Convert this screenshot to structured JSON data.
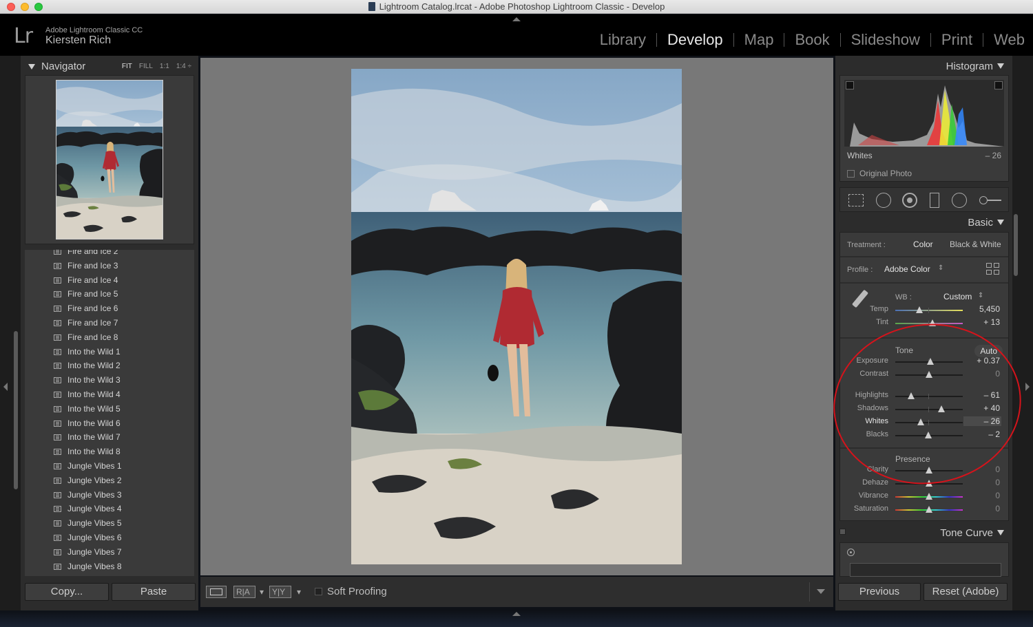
{
  "window": {
    "title": "Lightroom Catalog.lrcat - Adobe Photoshop Lightroom Classic - Develop"
  },
  "identity": {
    "logo": "Lr",
    "product": "Adobe Lightroom Classic CC",
    "user": "Kiersten Rich"
  },
  "modules": [
    "Library",
    "Develop",
    "Map",
    "Book",
    "Slideshow",
    "Print",
    "Web"
  ],
  "active_module": "Develop",
  "navigator": {
    "title": "Navigator",
    "zoom": [
      "FIT",
      "FILL",
      "1:1",
      "1:4 ÷"
    ]
  },
  "presets": [
    "Fire and Ice 2",
    "Fire and Ice 3",
    "Fire and Ice 4",
    "Fire and Ice 5",
    "Fire and Ice 6",
    "Fire and Ice 7",
    "Fire and Ice 8",
    "Into the Wild 1",
    "Into the Wild 2",
    "Into the Wild 3",
    "Into the Wild 4",
    "Into the Wild 5",
    "Into the Wild 6",
    "Into the Wild 7",
    "Into the Wild 8",
    "Jungle Vibes 1",
    "Jungle Vibes 2",
    "Jungle Vibes 3",
    "Jungle Vibes 4",
    "Jungle Vibes 5",
    "Jungle Vibes 6",
    "Jungle Vibes 7",
    "Jungle Vibes 8"
  ],
  "left_buttons": {
    "copy": "Copy...",
    "paste": "Paste"
  },
  "toolbar": {
    "soft_proofing": "Soft Proofing",
    "before_after_1": "R|A",
    "before_after_2": "Y|Y"
  },
  "histogram": {
    "title": "Histogram",
    "label": "Whites",
    "value": "– 26",
    "original_photo": "Original Photo"
  },
  "basic": {
    "title": "Basic",
    "treatment_label": "Treatment :",
    "treatment_color": "Color",
    "treatment_bw": "Black & White",
    "profile_label": "Profile :",
    "profile_value": "Adobe Color",
    "wb_label": "WB :",
    "wb_value": "Custom",
    "tone_title": "Tone",
    "auto": "Auto",
    "presence_title": "Presence",
    "sliders": [
      {
        "label": "Temp",
        "value": "5,450",
        "pos": 0.36,
        "group": "wb"
      },
      {
        "label": "Tint",
        "value": "+ 13",
        "pos": 0.55,
        "group": "wb"
      },
      {
        "label": "Exposure",
        "value": "+ 0.37",
        "pos": 0.52,
        "group": "tone"
      },
      {
        "label": "Contrast",
        "value": "0",
        "pos": 0.5,
        "group": "tone"
      },
      {
        "label": "Highlights",
        "value": "– 61",
        "pos": 0.23,
        "group": "tone2"
      },
      {
        "label": "Shadows",
        "value": "+ 40",
        "pos": 0.68,
        "group": "tone2"
      },
      {
        "label": "Whites",
        "value": "– 26",
        "pos": 0.38,
        "group": "tone2"
      },
      {
        "label": "Blacks",
        "value": "– 2",
        "pos": 0.49,
        "group": "tone2"
      },
      {
        "label": "Clarity",
        "value": "0",
        "pos": 0.5,
        "group": "presence"
      },
      {
        "label": "Dehaze",
        "value": "0",
        "pos": 0.5,
        "group": "presence"
      },
      {
        "label": "Vibrance",
        "value": "0",
        "pos": 0.5,
        "group": "presence"
      },
      {
        "label": "Saturation",
        "value": "0",
        "pos": 0.5,
        "group": "presence"
      }
    ]
  },
  "tone_curve": {
    "title": "Tone Curve"
  },
  "right_buttons": {
    "previous": "Previous",
    "reset": "Reset (Adobe)"
  },
  "colors": {
    "accent_annotation": "#d6131b",
    "panel": "#2c2c2c",
    "canvas": "#787878"
  }
}
